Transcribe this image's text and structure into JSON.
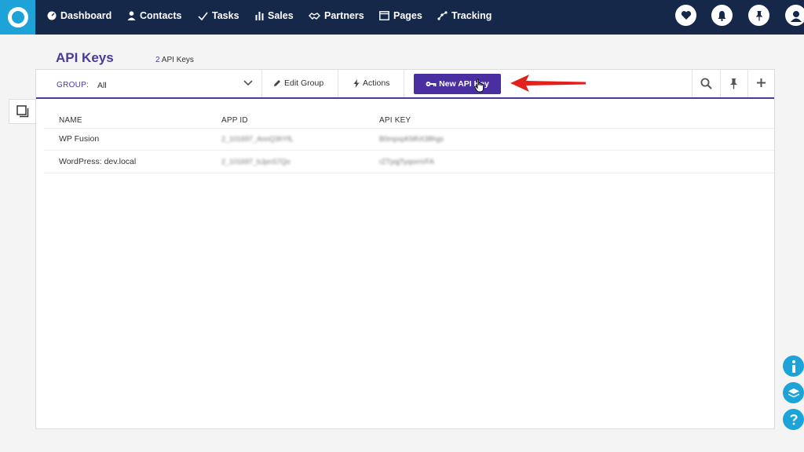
{
  "nav": {
    "items": [
      {
        "label": "Dashboard",
        "icon": "dashboard-icon"
      },
      {
        "label": "Contacts",
        "icon": "person-icon"
      },
      {
        "label": "Tasks",
        "icon": "check-icon"
      },
      {
        "label": "Sales",
        "icon": "bar-chart-icon"
      },
      {
        "label": "Partners",
        "icon": "handshake-icon"
      },
      {
        "label": "Pages",
        "icon": "window-icon"
      },
      {
        "label": "Tracking",
        "icon": "tracking-icon"
      }
    ],
    "right_icons": [
      "heart-icon",
      "bell-icon",
      "pin-icon",
      "avatar"
    ]
  },
  "page": {
    "title": "API Keys",
    "count_number": "2",
    "count_text": "API Keys"
  },
  "toolbar": {
    "group_label": "GROUP:",
    "group_value": "All",
    "edit_group": "Edit Group",
    "actions": "Actions",
    "new_api_key": "New API Key"
  },
  "table": {
    "columns": [
      "NAME",
      "APP ID",
      "API KEY"
    ],
    "rows": [
      {
        "name": "WP Fusion",
        "app_id": "2_101697_AnnQ3hYfL",
        "api_key": "B0mpxpKMhX38hgs"
      },
      {
        "name": "WordPress: dev.local",
        "app_id": "2_101697_bJpnS7Qo",
        "api_key": "rZTpqjTyqomVFA"
      }
    ]
  },
  "float_buttons": [
    "info-icon",
    "learn-icon",
    "help-icon"
  ],
  "colors": {
    "nav_bg": "#16284a",
    "logo_bg": "#1ea3d8",
    "brand_purple": "#4a3a9a",
    "button_purple": "#4a2fa0",
    "annotation_red": "#e3201b"
  }
}
